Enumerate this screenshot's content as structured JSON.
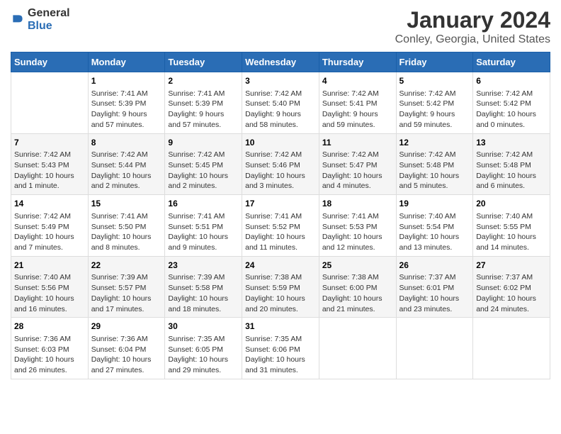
{
  "logo": {
    "general": "General",
    "blue": "Blue"
  },
  "title": "January 2024",
  "subtitle": "Conley, Georgia, United States",
  "headers": [
    "Sunday",
    "Monday",
    "Tuesday",
    "Wednesday",
    "Thursday",
    "Friday",
    "Saturday"
  ],
  "weeks": [
    [
      {
        "day": "",
        "info": ""
      },
      {
        "day": "1",
        "info": "Sunrise: 7:41 AM\nSunset: 5:39 PM\nDaylight: 9 hours\nand 57 minutes."
      },
      {
        "day": "2",
        "info": "Sunrise: 7:41 AM\nSunset: 5:39 PM\nDaylight: 9 hours\nand 57 minutes."
      },
      {
        "day": "3",
        "info": "Sunrise: 7:42 AM\nSunset: 5:40 PM\nDaylight: 9 hours\nand 58 minutes."
      },
      {
        "day": "4",
        "info": "Sunrise: 7:42 AM\nSunset: 5:41 PM\nDaylight: 9 hours\nand 59 minutes."
      },
      {
        "day": "5",
        "info": "Sunrise: 7:42 AM\nSunset: 5:42 PM\nDaylight: 9 hours\nand 59 minutes."
      },
      {
        "day": "6",
        "info": "Sunrise: 7:42 AM\nSunset: 5:42 PM\nDaylight: 10 hours\nand 0 minutes."
      }
    ],
    [
      {
        "day": "7",
        "info": "Sunrise: 7:42 AM\nSunset: 5:43 PM\nDaylight: 10 hours\nand 1 minute."
      },
      {
        "day": "8",
        "info": "Sunrise: 7:42 AM\nSunset: 5:44 PM\nDaylight: 10 hours\nand 2 minutes."
      },
      {
        "day": "9",
        "info": "Sunrise: 7:42 AM\nSunset: 5:45 PM\nDaylight: 10 hours\nand 2 minutes."
      },
      {
        "day": "10",
        "info": "Sunrise: 7:42 AM\nSunset: 5:46 PM\nDaylight: 10 hours\nand 3 minutes."
      },
      {
        "day": "11",
        "info": "Sunrise: 7:42 AM\nSunset: 5:47 PM\nDaylight: 10 hours\nand 4 minutes."
      },
      {
        "day": "12",
        "info": "Sunrise: 7:42 AM\nSunset: 5:48 PM\nDaylight: 10 hours\nand 5 minutes."
      },
      {
        "day": "13",
        "info": "Sunrise: 7:42 AM\nSunset: 5:48 PM\nDaylight: 10 hours\nand 6 minutes."
      }
    ],
    [
      {
        "day": "14",
        "info": "Sunrise: 7:42 AM\nSunset: 5:49 PM\nDaylight: 10 hours\nand 7 minutes."
      },
      {
        "day": "15",
        "info": "Sunrise: 7:41 AM\nSunset: 5:50 PM\nDaylight: 10 hours\nand 8 minutes."
      },
      {
        "day": "16",
        "info": "Sunrise: 7:41 AM\nSunset: 5:51 PM\nDaylight: 10 hours\nand 9 minutes."
      },
      {
        "day": "17",
        "info": "Sunrise: 7:41 AM\nSunset: 5:52 PM\nDaylight: 10 hours\nand 11 minutes."
      },
      {
        "day": "18",
        "info": "Sunrise: 7:41 AM\nSunset: 5:53 PM\nDaylight: 10 hours\nand 12 minutes."
      },
      {
        "day": "19",
        "info": "Sunrise: 7:40 AM\nSunset: 5:54 PM\nDaylight: 10 hours\nand 13 minutes."
      },
      {
        "day": "20",
        "info": "Sunrise: 7:40 AM\nSunset: 5:55 PM\nDaylight: 10 hours\nand 14 minutes."
      }
    ],
    [
      {
        "day": "21",
        "info": "Sunrise: 7:40 AM\nSunset: 5:56 PM\nDaylight: 10 hours\nand 16 minutes."
      },
      {
        "day": "22",
        "info": "Sunrise: 7:39 AM\nSunset: 5:57 PM\nDaylight: 10 hours\nand 17 minutes."
      },
      {
        "day": "23",
        "info": "Sunrise: 7:39 AM\nSunset: 5:58 PM\nDaylight: 10 hours\nand 18 minutes."
      },
      {
        "day": "24",
        "info": "Sunrise: 7:38 AM\nSunset: 5:59 PM\nDaylight: 10 hours\nand 20 minutes."
      },
      {
        "day": "25",
        "info": "Sunrise: 7:38 AM\nSunset: 6:00 PM\nDaylight: 10 hours\nand 21 minutes."
      },
      {
        "day": "26",
        "info": "Sunrise: 7:37 AM\nSunset: 6:01 PM\nDaylight: 10 hours\nand 23 minutes."
      },
      {
        "day": "27",
        "info": "Sunrise: 7:37 AM\nSunset: 6:02 PM\nDaylight: 10 hours\nand 24 minutes."
      }
    ],
    [
      {
        "day": "28",
        "info": "Sunrise: 7:36 AM\nSunset: 6:03 PM\nDaylight: 10 hours\nand 26 minutes."
      },
      {
        "day": "29",
        "info": "Sunrise: 7:36 AM\nSunset: 6:04 PM\nDaylight: 10 hours\nand 27 minutes."
      },
      {
        "day": "30",
        "info": "Sunrise: 7:35 AM\nSunset: 6:05 PM\nDaylight: 10 hours\nand 29 minutes."
      },
      {
        "day": "31",
        "info": "Sunrise: 7:35 AM\nSunset: 6:06 PM\nDaylight: 10 hours\nand 31 minutes."
      },
      {
        "day": "",
        "info": ""
      },
      {
        "day": "",
        "info": ""
      },
      {
        "day": "",
        "info": ""
      }
    ]
  ]
}
